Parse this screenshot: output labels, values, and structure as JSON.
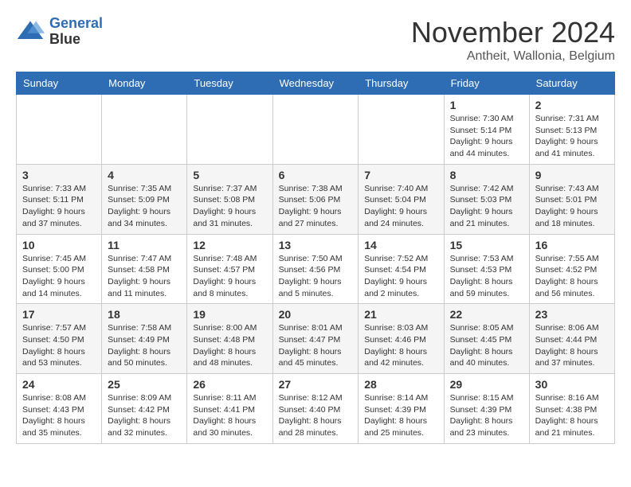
{
  "logo": {
    "line1": "General",
    "line2": "Blue"
  },
  "title": "November 2024",
  "subtitle": "Antheit, Wallonia, Belgium",
  "days_header": [
    "Sunday",
    "Monday",
    "Tuesday",
    "Wednesday",
    "Thursday",
    "Friday",
    "Saturday"
  ],
  "weeks": [
    [
      {
        "day": "",
        "info": ""
      },
      {
        "day": "",
        "info": ""
      },
      {
        "day": "",
        "info": ""
      },
      {
        "day": "",
        "info": ""
      },
      {
        "day": "",
        "info": ""
      },
      {
        "day": "1",
        "info": "Sunrise: 7:30 AM\nSunset: 5:14 PM\nDaylight: 9 hours\nand 44 minutes."
      },
      {
        "day": "2",
        "info": "Sunrise: 7:31 AM\nSunset: 5:13 PM\nDaylight: 9 hours\nand 41 minutes."
      }
    ],
    [
      {
        "day": "3",
        "info": "Sunrise: 7:33 AM\nSunset: 5:11 PM\nDaylight: 9 hours\nand 37 minutes."
      },
      {
        "day": "4",
        "info": "Sunrise: 7:35 AM\nSunset: 5:09 PM\nDaylight: 9 hours\nand 34 minutes."
      },
      {
        "day": "5",
        "info": "Sunrise: 7:37 AM\nSunset: 5:08 PM\nDaylight: 9 hours\nand 31 minutes."
      },
      {
        "day": "6",
        "info": "Sunrise: 7:38 AM\nSunset: 5:06 PM\nDaylight: 9 hours\nand 27 minutes."
      },
      {
        "day": "7",
        "info": "Sunrise: 7:40 AM\nSunset: 5:04 PM\nDaylight: 9 hours\nand 24 minutes."
      },
      {
        "day": "8",
        "info": "Sunrise: 7:42 AM\nSunset: 5:03 PM\nDaylight: 9 hours\nand 21 minutes."
      },
      {
        "day": "9",
        "info": "Sunrise: 7:43 AM\nSunset: 5:01 PM\nDaylight: 9 hours\nand 18 minutes."
      }
    ],
    [
      {
        "day": "10",
        "info": "Sunrise: 7:45 AM\nSunset: 5:00 PM\nDaylight: 9 hours\nand 14 minutes."
      },
      {
        "day": "11",
        "info": "Sunrise: 7:47 AM\nSunset: 4:58 PM\nDaylight: 9 hours\nand 11 minutes."
      },
      {
        "day": "12",
        "info": "Sunrise: 7:48 AM\nSunset: 4:57 PM\nDaylight: 9 hours\nand 8 minutes."
      },
      {
        "day": "13",
        "info": "Sunrise: 7:50 AM\nSunset: 4:56 PM\nDaylight: 9 hours\nand 5 minutes."
      },
      {
        "day": "14",
        "info": "Sunrise: 7:52 AM\nSunset: 4:54 PM\nDaylight: 9 hours\nand 2 minutes."
      },
      {
        "day": "15",
        "info": "Sunrise: 7:53 AM\nSunset: 4:53 PM\nDaylight: 8 hours\nand 59 minutes."
      },
      {
        "day": "16",
        "info": "Sunrise: 7:55 AM\nSunset: 4:52 PM\nDaylight: 8 hours\nand 56 minutes."
      }
    ],
    [
      {
        "day": "17",
        "info": "Sunrise: 7:57 AM\nSunset: 4:50 PM\nDaylight: 8 hours\nand 53 minutes."
      },
      {
        "day": "18",
        "info": "Sunrise: 7:58 AM\nSunset: 4:49 PM\nDaylight: 8 hours\nand 50 minutes."
      },
      {
        "day": "19",
        "info": "Sunrise: 8:00 AM\nSunset: 4:48 PM\nDaylight: 8 hours\nand 48 minutes."
      },
      {
        "day": "20",
        "info": "Sunrise: 8:01 AM\nSunset: 4:47 PM\nDaylight: 8 hours\nand 45 minutes."
      },
      {
        "day": "21",
        "info": "Sunrise: 8:03 AM\nSunset: 4:46 PM\nDaylight: 8 hours\nand 42 minutes."
      },
      {
        "day": "22",
        "info": "Sunrise: 8:05 AM\nSunset: 4:45 PM\nDaylight: 8 hours\nand 40 minutes."
      },
      {
        "day": "23",
        "info": "Sunrise: 8:06 AM\nSunset: 4:44 PM\nDaylight: 8 hours\nand 37 minutes."
      }
    ],
    [
      {
        "day": "24",
        "info": "Sunrise: 8:08 AM\nSunset: 4:43 PM\nDaylight: 8 hours\nand 35 minutes."
      },
      {
        "day": "25",
        "info": "Sunrise: 8:09 AM\nSunset: 4:42 PM\nDaylight: 8 hours\nand 32 minutes."
      },
      {
        "day": "26",
        "info": "Sunrise: 8:11 AM\nSunset: 4:41 PM\nDaylight: 8 hours\nand 30 minutes."
      },
      {
        "day": "27",
        "info": "Sunrise: 8:12 AM\nSunset: 4:40 PM\nDaylight: 8 hours\nand 28 minutes."
      },
      {
        "day": "28",
        "info": "Sunrise: 8:14 AM\nSunset: 4:39 PM\nDaylight: 8 hours\nand 25 minutes."
      },
      {
        "day": "29",
        "info": "Sunrise: 8:15 AM\nSunset: 4:39 PM\nDaylight: 8 hours\nand 23 minutes."
      },
      {
        "day": "30",
        "info": "Sunrise: 8:16 AM\nSunset: 4:38 PM\nDaylight: 8 hours\nand 21 minutes."
      }
    ]
  ]
}
